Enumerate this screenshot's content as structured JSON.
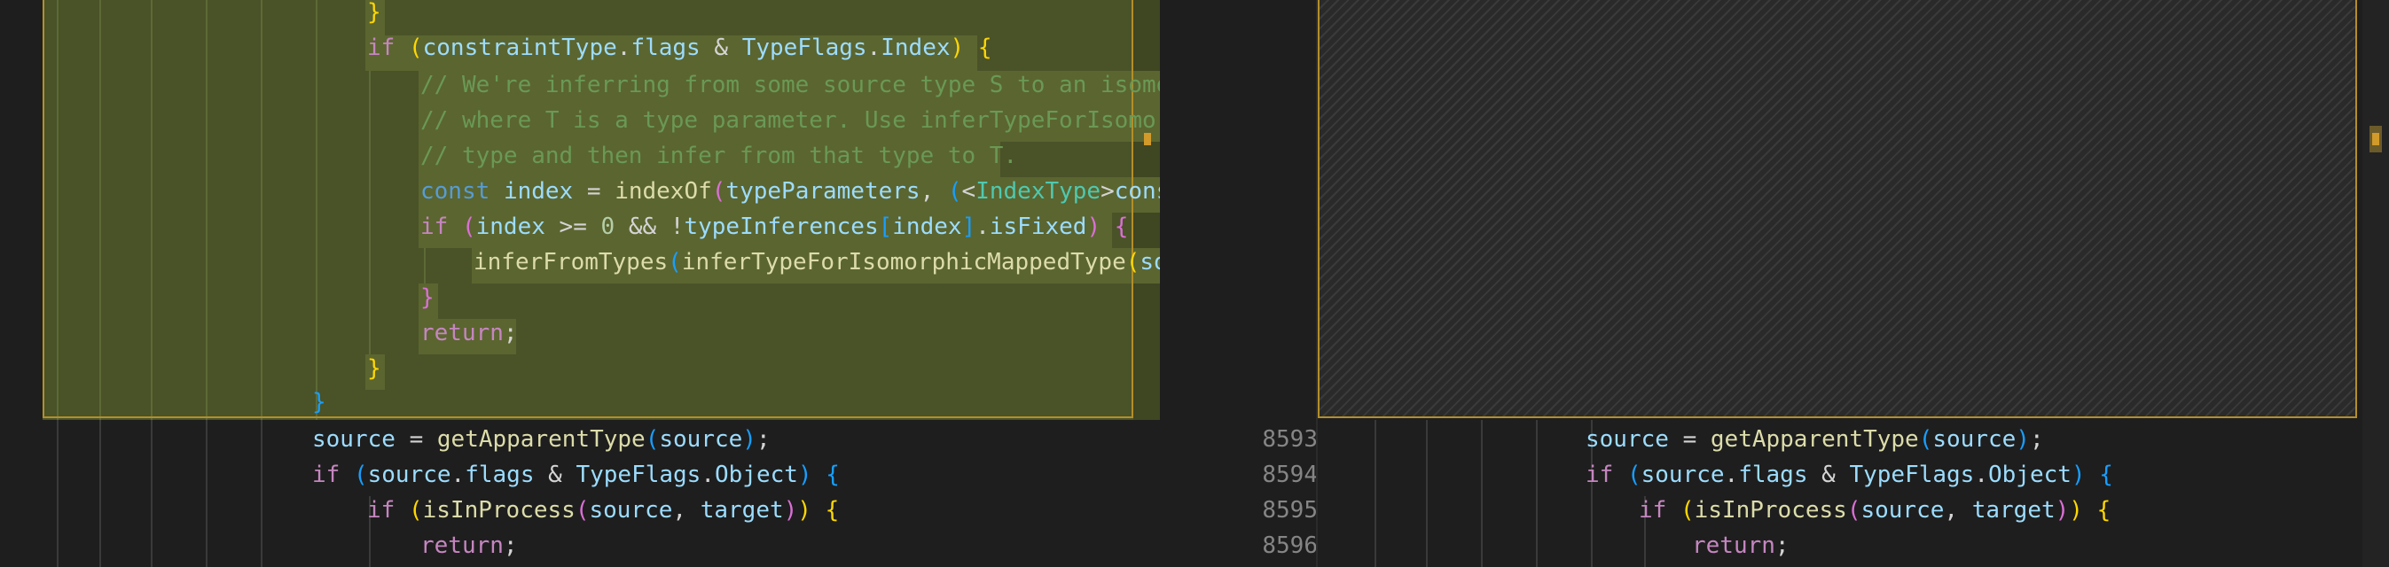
{
  "left_code": {
    "inserted": [
      {
        "text": "}",
        "indent": 6
      },
      {
        "text": "if (constraintType.flags & TypeFlags.Index) {",
        "indent": 6
      },
      {
        "text": "// We're inferring from some source type S to an isomor",
        "indent": 7
      },
      {
        "text": "// where T is a type parameter. Use inferTypeForIsomorp",
        "indent": 7
      },
      {
        "text": "// type and then infer from that type to T.",
        "indent": 7
      },
      {
        "text": "const index = indexOf(typeParameters, (<IndexType>const",
        "indent": 7
      },
      {
        "text": "if (index >= 0 && !typeInferences[index].isFixed) {",
        "indent": 7
      },
      {
        "text": "inferFromTypes(inferTypeForIsomorphicMappedType(sou",
        "indent": 8
      },
      {
        "text": "}",
        "indent": 7
      },
      {
        "text": "return;",
        "indent": 7
      },
      {
        "text": "}",
        "indent": 6
      }
    ],
    "after": [
      {
        "text": "}",
        "indent": 5
      },
      {
        "text": "source = getApparentType(source);",
        "indent": 5
      },
      {
        "text": "if (source.flags & TypeFlags.Object) {",
        "indent": 5
      },
      {
        "text": "if (isInProcess(source, target)) {",
        "indent": 6
      },
      {
        "text": "return;",
        "indent": 7
      }
    ]
  },
  "line_numbers": [
    "8593",
    "8594",
    "8595",
    "8596"
  ],
  "right_code": [
    {
      "text": "source = getApparentType(source);",
      "indent": 5
    },
    {
      "text": "if (source.flags & TypeFlags.Object) {",
      "indent": 5
    },
    {
      "text": "if (isInProcess(source, target)) {",
      "indent": 6
    },
    {
      "text": "return;",
      "indent": 7
    }
  ],
  "colors": {
    "keyword": "#c586c0",
    "function": "#dcdcaa",
    "variable": "#9cdcfe",
    "type": "#4ec9b0",
    "comment": "#6a9955",
    "insert_background": "#4a5228",
    "diff_border": "#b38f2a"
  }
}
